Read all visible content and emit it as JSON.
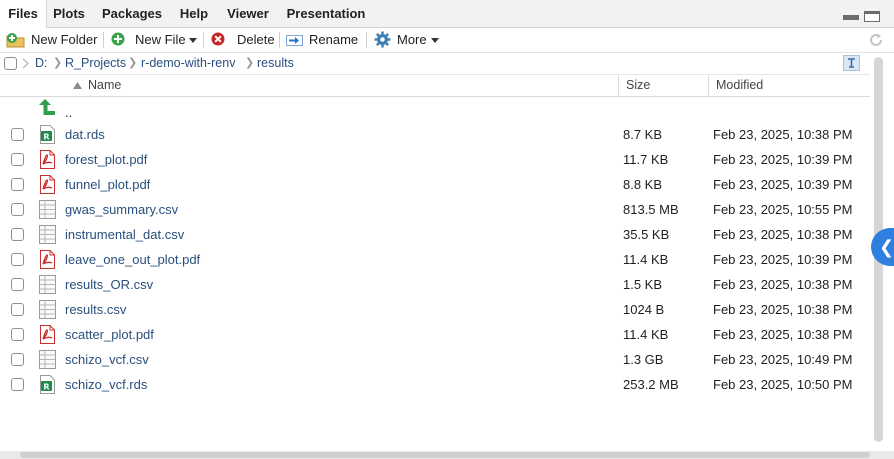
{
  "tabs": [
    {
      "label": "Files",
      "active": true
    },
    {
      "label": "Plots"
    },
    {
      "label": "Packages"
    },
    {
      "label": "Help"
    },
    {
      "label": "Viewer"
    },
    {
      "label": "Presentation"
    }
  ],
  "toolbar": {
    "new_folder": "New Folder",
    "new_file": "New File",
    "delete": "Delete",
    "rename": "Rename",
    "more": "More"
  },
  "breadcrumb": [
    "D:",
    "R_Projects",
    "r-demo-with-renv",
    "results"
  ],
  "columns": {
    "name": "Name",
    "size": "Size",
    "modified": "Modified"
  },
  "parent_dir": "..",
  "files": [
    {
      "name": "dat.rds",
      "size": "8.7 KB",
      "modified": "Feb 23, 2025, 10:38 PM",
      "icon": "rds-file-icon"
    },
    {
      "name": "forest_plot.pdf",
      "size": "11.7 KB",
      "modified": "Feb 23, 2025, 10:39 PM",
      "icon": "pdf-file-icon"
    },
    {
      "name": "funnel_plot.pdf",
      "size": "8.8 KB",
      "modified": "Feb 23, 2025, 10:39 PM",
      "icon": "pdf-file-icon"
    },
    {
      "name": "gwas_summary.csv",
      "size": "813.5 MB",
      "modified": "Feb 23, 2025, 10:55 PM",
      "icon": "csv-file-icon"
    },
    {
      "name": "instrumental_dat.csv",
      "size": "35.5 KB",
      "modified": "Feb 23, 2025, 10:38 PM",
      "icon": "csv-file-icon"
    },
    {
      "name": "leave_one_out_plot.pdf",
      "size": "11.4 KB",
      "modified": "Feb 23, 2025, 10:39 PM",
      "icon": "pdf-file-icon"
    },
    {
      "name": "results_OR.csv",
      "size": "1.5 KB",
      "modified": "Feb 23, 2025, 10:38 PM",
      "icon": "csv-file-icon"
    },
    {
      "name": "results.csv",
      "size": "1024 B",
      "modified": "Feb 23, 2025, 10:38 PM",
      "icon": "csv-file-icon"
    },
    {
      "name": "scatter_plot.pdf",
      "size": "11.4 KB",
      "modified": "Feb 23, 2025, 10:38 PM",
      "icon": "pdf-file-icon"
    },
    {
      "name": "schizo_vcf.csv",
      "size": "1.3 GB",
      "modified": "Feb 23, 2025, 10:49 PM",
      "icon": "csv-file-icon"
    },
    {
      "name": "schizo_vcf.rds",
      "size": "253.2 MB",
      "modified": "Feb 23, 2025, 10:50 PM",
      "icon": "rds-file-icon"
    }
  ],
  "colors": {
    "link": "#2a4f7c",
    "accent": "#2f7fe0",
    "pdf_red": "#c8302e",
    "rds_green": "#1f8a4c"
  }
}
